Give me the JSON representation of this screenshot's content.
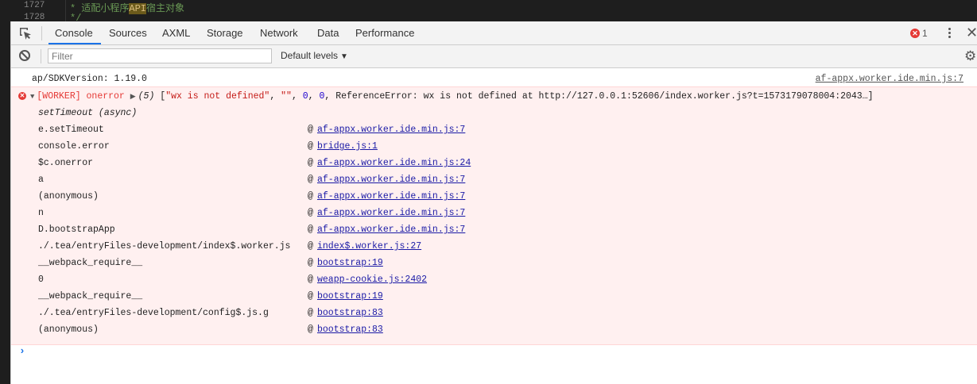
{
  "editor": {
    "lines": [
      {
        "num": "1727",
        "pre": "* 适配小程序",
        "hl": "API",
        "post": "宿主对象"
      },
      {
        "num": "1728",
        "pre": "*/",
        "hl": "",
        "post": ""
      }
    ]
  },
  "tabs": [
    "Console",
    "Sources",
    "AXML",
    "Storage",
    "Network",
    "Data",
    "Performance"
  ],
  "error_count": "1",
  "filter": {
    "placeholder": "Filter",
    "value": ""
  },
  "levels_label": "Default levels",
  "console": {
    "info": {
      "message": "ap/SDKVersion: 1.19.0",
      "source": "af-appx.worker.ide.min.js:7"
    },
    "error": {
      "tag": "[WORKER] onerror",
      "count": "(5)",
      "open": "[",
      "arg1": "\"wx is not defined\"",
      "sep1": ", ",
      "arg2": "\"\"",
      "sep2": ", ",
      "arg3": "0",
      "sep3": ", ",
      "arg4": "0",
      "sep4": ", ",
      "tail": "ReferenceError: wx is not defined at http://127.0.0.1:52606/index.worker.js?t=1573179078004:2043…]",
      "async_label": "setTimeout (async)",
      "stack": [
        {
          "fn": "e.setTimeout",
          "at": "@",
          "link": "af-appx.worker.ide.min.js:7"
        },
        {
          "fn": "console.error",
          "at": "@",
          "link": "bridge.js:1"
        },
        {
          "fn": "$c.onerror",
          "at": "@",
          "link": "af-appx.worker.ide.min.js:24"
        },
        {
          "fn": "a",
          "at": "@",
          "link": "af-appx.worker.ide.min.js:7"
        },
        {
          "fn": "(anonymous)",
          "at": "@",
          "link": "af-appx.worker.ide.min.js:7"
        },
        {
          "fn": "n",
          "at": "@",
          "link": "af-appx.worker.ide.min.js:7"
        },
        {
          "fn": "D.bootstrapApp",
          "at": "@",
          "link": "af-appx.worker.ide.min.js:7"
        },
        {
          "fn": "./.tea/entryFiles-development/index$.worker.js",
          "at": "@",
          "link": "index$.worker.js:27"
        },
        {
          "fn": "__webpack_require__",
          "at": "@",
          "link": "bootstrap:19"
        },
        {
          "fn": "0",
          "at": "@",
          "link": "weapp-cookie.js:2402"
        },
        {
          "fn": "__webpack_require__",
          "at": "@",
          "link": "bootstrap:19"
        },
        {
          "fn": "./.tea/entryFiles-development/config$.js.g",
          "at": "@",
          "link": "bootstrap:83"
        },
        {
          "fn": "(anonymous)",
          "at": "@",
          "link": "bootstrap:83"
        }
      ]
    }
  }
}
